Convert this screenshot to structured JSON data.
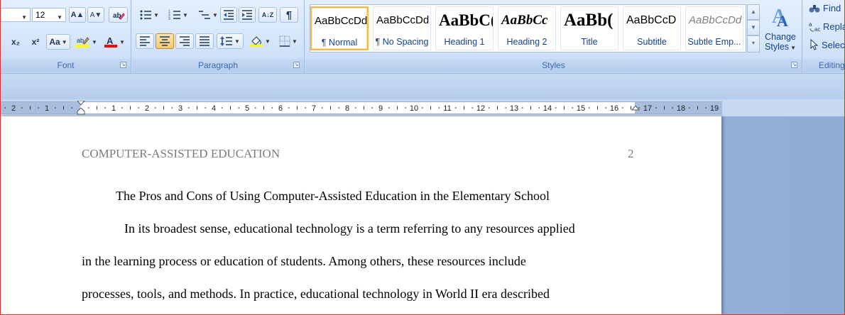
{
  "font_group": {
    "font_size": "12",
    "label": "Font",
    "grow_icon": "A▲",
    "shrink_icon": "A▼",
    "change_case": "Aa",
    "subscript": "x₂",
    "superscript": "x²",
    "highlight_color": "#ffff00",
    "font_color": "#ff0000"
  },
  "paragraph_group": {
    "label": "Paragraph",
    "sort": "A↓Z",
    "pilcrow": "¶"
  },
  "styles_group": {
    "label": "Styles",
    "items": [
      {
        "sample": "AaBbCcDd",
        "name": "¶ Normal",
        "selected": true
      },
      {
        "sample": "AaBbCcDd",
        "name": "¶ No Spacing",
        "selected": false
      },
      {
        "sample": "AaBbC(",
        "name": "Heading 1",
        "selected": false
      },
      {
        "sample": "AaBbCc",
        "name": "Heading 2",
        "selected": false
      },
      {
        "sample": "AaBb(",
        "name": "Title",
        "selected": false
      },
      {
        "sample": "AaBbCcD",
        "name": "Subtitle",
        "selected": false
      },
      {
        "sample": "AaBbCcDd",
        "name": "Subtle Emp...",
        "selected": false
      }
    ],
    "change_styles": [
      "Change",
      "Styles"
    ]
  },
  "editing_group": {
    "label": "Editing",
    "find": "Find",
    "replace": "Repla",
    "select": "Selec"
  },
  "ruler": {
    "left_labels": [
      "2",
      "1"
    ],
    "right_labels": [
      "1",
      "2",
      "3",
      "4",
      "5",
      "6",
      "7",
      "8",
      "9",
      "10",
      "11",
      "12",
      "13",
      "14",
      "15",
      "16",
      "17",
      "18",
      "19"
    ]
  },
  "document": {
    "running_head": "COMPUTER-ASSISTED EDUCATION",
    "page_number": "2",
    "title": "The Pros and Cons of Using Computer-Assisted Education in the Elementary School",
    "lines": [
      "In its broadest sense, educational technology is a term referring to any resources applied",
      "in the learning process or education of students. Among others, these resources include",
      "processes, tools, and methods. In practice, educational technology in World II era described"
    ]
  }
}
